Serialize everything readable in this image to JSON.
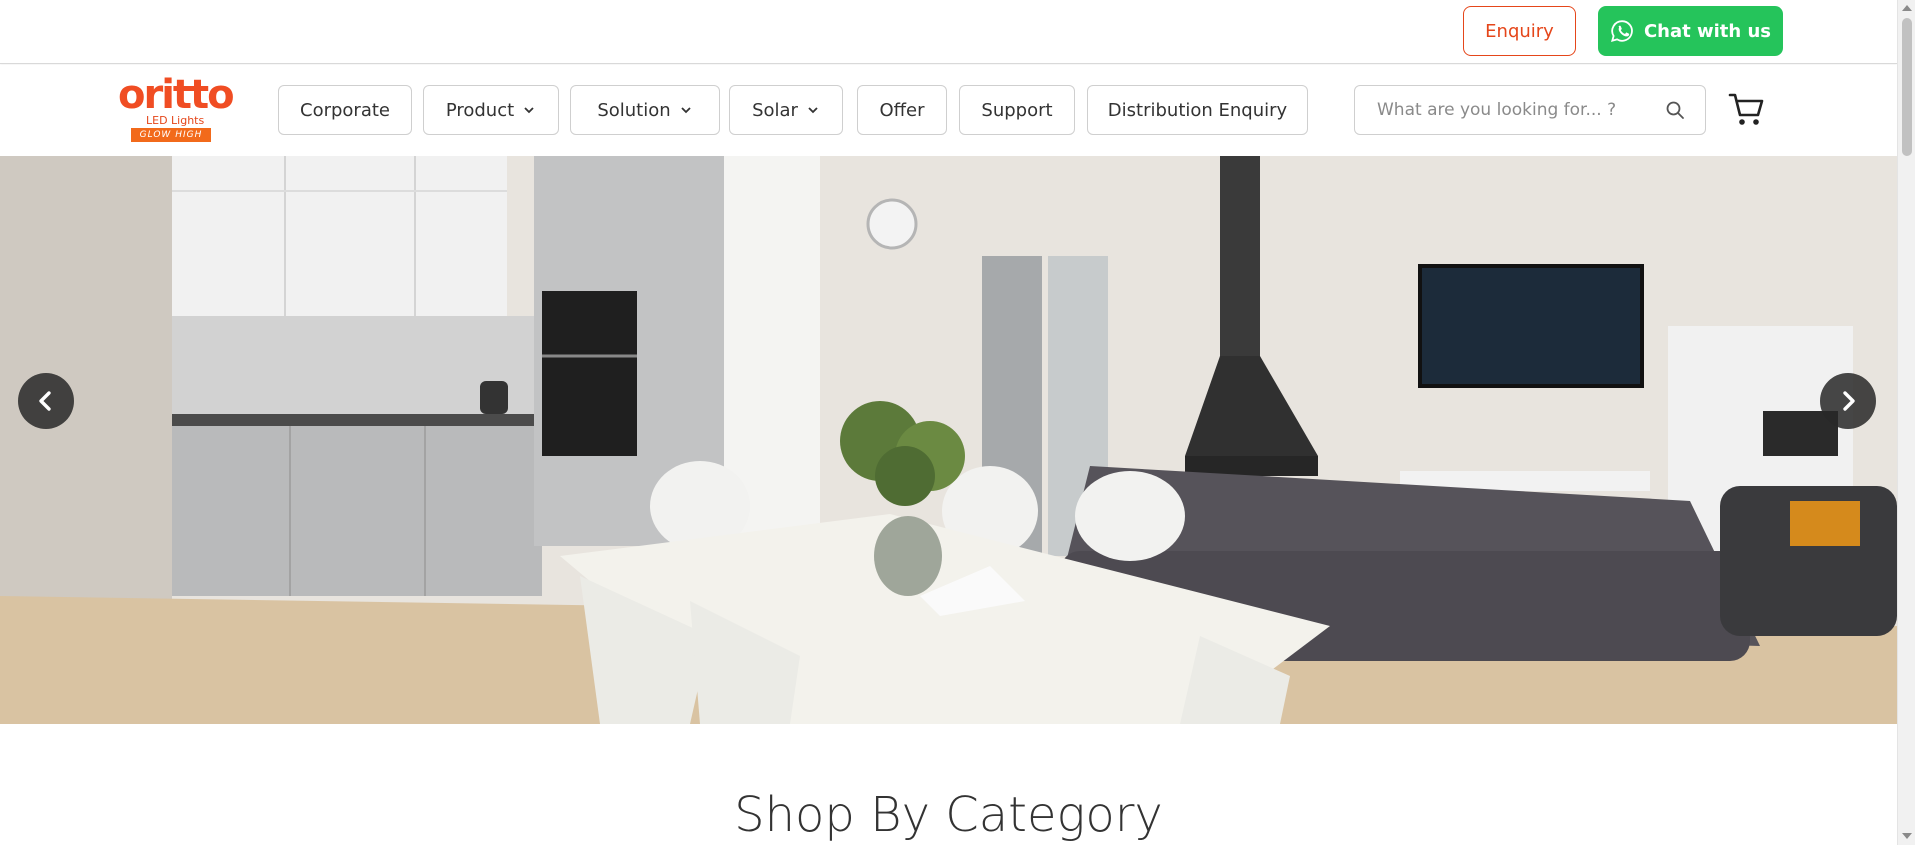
{
  "topbar": {
    "enquiry_label": "Enquiry",
    "chat_label": "Chat with us",
    "chat_icon": "whatsapp-icon"
  },
  "logo": {
    "word": "oritto",
    "sub": "LED Lights",
    "tagline": "GLOW HIGH"
  },
  "nav": {
    "items": [
      {
        "label": "Corporate",
        "has_dropdown": false
      },
      {
        "label": "Product",
        "has_dropdown": true
      },
      {
        "label": "Solution",
        "has_dropdown": true
      },
      {
        "label": "Solar",
        "has_dropdown": true
      },
      {
        "label": "Offer",
        "has_dropdown": false
      },
      {
        "label": "Support",
        "has_dropdown": false
      },
      {
        "label": "Distribution Enquiry",
        "has_dropdown": false
      }
    ],
    "search_placeholder": "What are you looking for... ?",
    "search_icon": "search-icon",
    "cart_icon": "cart-icon"
  },
  "hero": {
    "image_subject": "kitchen-living-room-interior",
    "prev_icon": "chevron-left-icon",
    "next_icon": "chevron-right-icon"
  },
  "section": {
    "title": "Shop By Category"
  },
  "colors": {
    "brand_orange": "#e5461a",
    "whatsapp_green": "#25c45b"
  }
}
